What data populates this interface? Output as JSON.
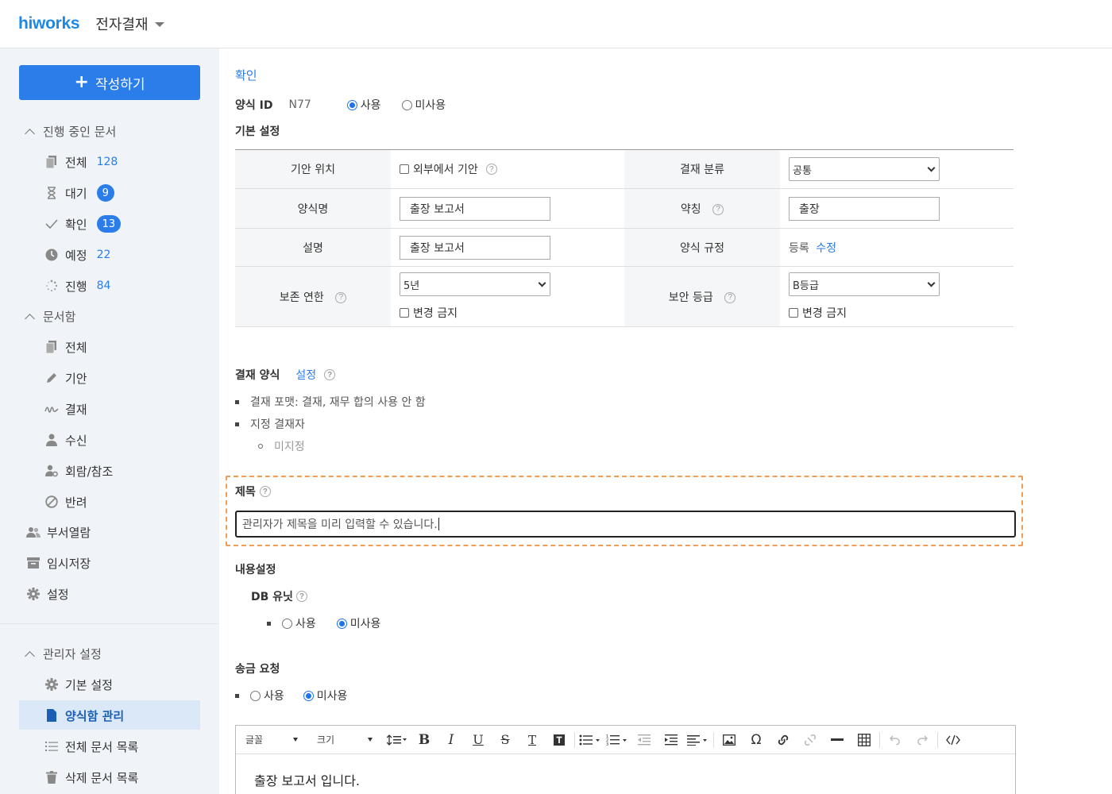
{
  "header": {
    "logo": "hiworks",
    "app_title": "전자결재"
  },
  "sidebar": {
    "write_button": "작성하기",
    "group_in_progress": "진행 중인 문서",
    "in_progress_items": [
      {
        "label": "전체",
        "count": "128"
      },
      {
        "label": "대기",
        "badge": "9"
      },
      {
        "label": "확인",
        "badge": "13"
      },
      {
        "label": "예정",
        "count": "22"
      },
      {
        "label": "진행",
        "count": "84"
      }
    ],
    "group_box": "문서함",
    "box_items": [
      "전체",
      "기안",
      "결재",
      "수신",
      "회람/참조",
      "반려"
    ],
    "top_items": [
      "부서열람",
      "임시저장",
      "설정"
    ],
    "group_admin": "관리자 설정",
    "admin_items": [
      "기본 설정",
      "양식함 관리",
      "전체 문서 목록",
      "삭제 문서 목록"
    ]
  },
  "main": {
    "breadcrumb": "확인",
    "form_id_label": "양식 ID",
    "form_id_value": "N77",
    "use_label": "사용",
    "unused_label": "미사용",
    "basic_settings_title": "기본 설정",
    "rows": {
      "draft_location_label": "기안 위치",
      "draft_external": "외부에서 기안",
      "approval_category_label": "결재 분류",
      "approval_category_value": "공통",
      "form_name_label": "양식명",
      "form_name_value": "출장 보고서",
      "abbrev_label": "약칭",
      "abbrev_value": "출장",
      "description_label": "설명",
      "description_value": "출장 보고서",
      "form_rules_label": "양식 규정",
      "form_rules_register": "등록",
      "form_rules_edit": "수정",
      "retention_label": "보존 연한",
      "retention_value": "5년",
      "retention_lock": "변경 금지",
      "security_label": "보안 등급",
      "security_value": "B등급",
      "security_lock": "변경 금지"
    },
    "approval_form_title": "결재 양식",
    "approval_form_link": "설정",
    "approval_bullets": [
      "결재 포맷: 결재, 재무 합의 사용 안 함",
      "지정 결재자"
    ],
    "approval_sub_bullet": "미지정",
    "subject_title": "제목",
    "subject_value": "관리자가 제목을 미리 입력할 수 있습니다.",
    "content_settings_title": "내용설정",
    "db_unit_title": "DB 유닛",
    "db_unit_use": "사용",
    "db_unit_unused": "미사용",
    "remit_title": "송금 요청",
    "remit_use": "사용",
    "remit_unused": "미사용",
    "editor": {
      "font_label": "글꼴",
      "size_label": "크기",
      "body": "출장 보고서 입니다."
    }
  }
}
